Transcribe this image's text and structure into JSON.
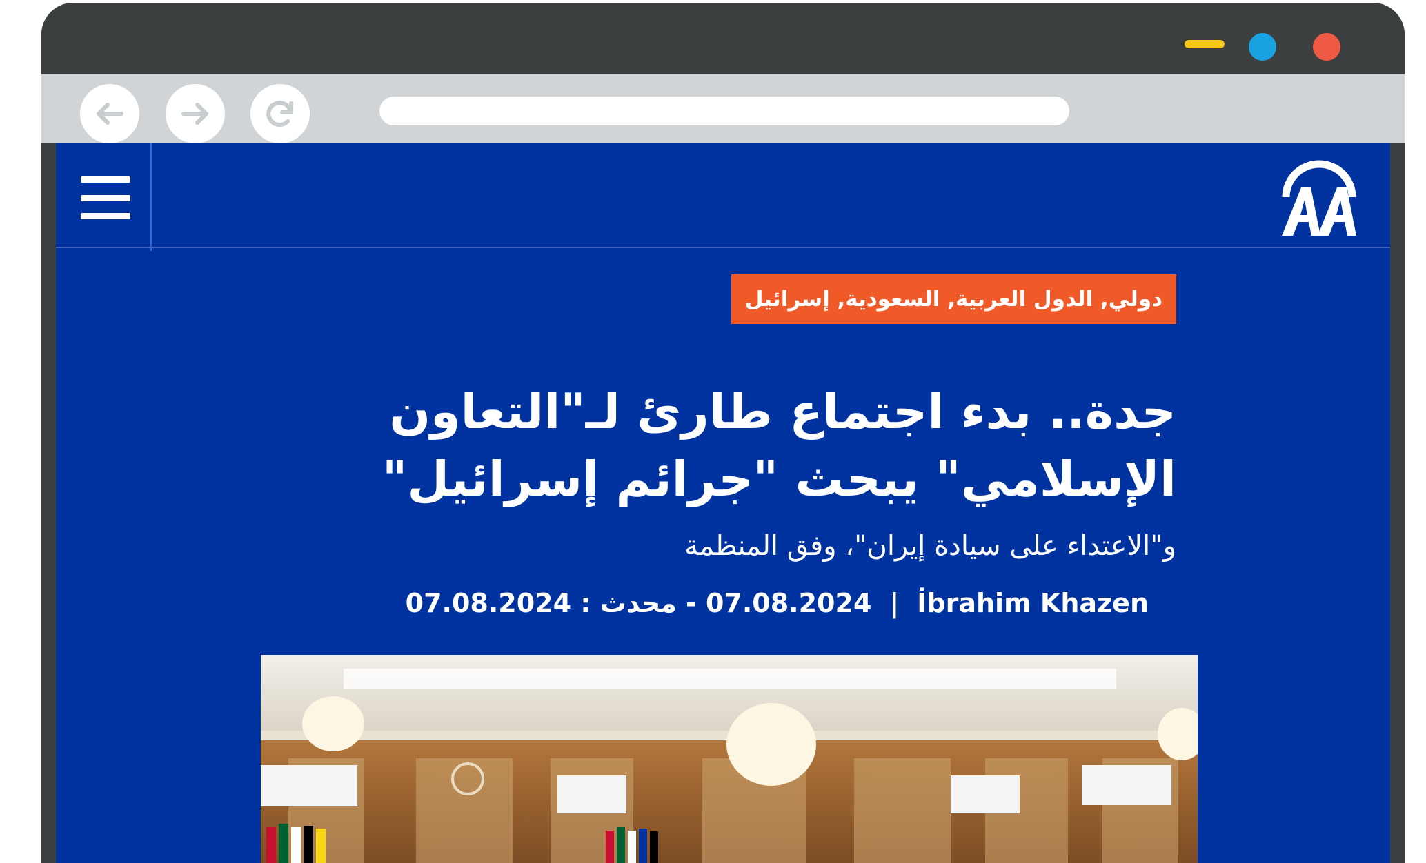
{
  "browser": {
    "window_controls": {
      "minimize_color": "#f5c518",
      "maximize_color": "#1aa3e0",
      "close_color": "#ef5a45"
    },
    "nav_icons": [
      "arrow-left-icon",
      "arrow-right-icon",
      "reload-icon"
    ],
    "address_value": ""
  },
  "site": {
    "brand_color": "#0033a0",
    "logo_icon": "aa-logo-icon",
    "menu_icon": "hamburger-menu-icon"
  },
  "article": {
    "category": "دولي, الدول العربية, السعودية, إسرائيل",
    "category_color": "#f05a28",
    "headline": "جدة.. بدء اجتماع طارئ لـ\"التعاون الإسلامي\" يبحث \"جرائم إسرائيل\"",
    "subtitle": "و\"الاعتداء على سيادة إيران\"، وفق المنظمة",
    "author": "İbrahim Khazen",
    "separator": "|",
    "dates": "07.08.2024 - محدث : 07.08.2024"
  }
}
